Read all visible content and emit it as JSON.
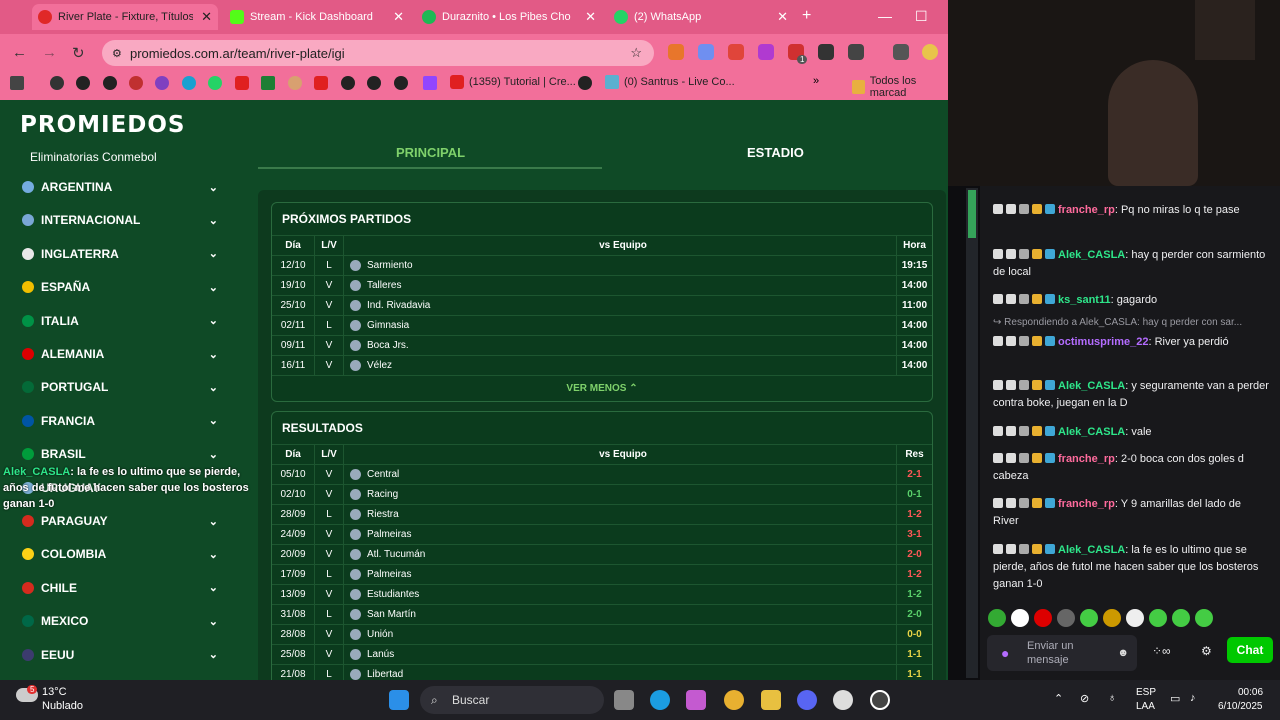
{
  "browser": {
    "tabs": [
      {
        "title": "River Plate - Fixture, Títulos y",
        "active": true
      },
      {
        "title": "Stream - Kick Dashboard"
      },
      {
        "title": "Duraznito • Los Pibes Cho"
      },
      {
        "title": "(2) WhatsApp"
      }
    ],
    "url": "promiedos.com.ar/team/river-plate/igi",
    "bookmarks": [
      "(1359) Tutorial | Cre...",
      "(0) Santrus - Live Co...",
      "Todos los marcad"
    ],
    "ext_badge": "1"
  },
  "site": {
    "logo": "PROMIEDOS",
    "subtitle": "Eliminatorias Conmebol",
    "countries": [
      {
        "name": "ARGENTINA",
        "color": "#74acdf"
      },
      {
        "name": "INTERNACIONAL",
        "color": "#7aa7d6"
      },
      {
        "name": "INGLATERRA",
        "color": "#e8e8e8"
      },
      {
        "name": "ESPAÑA",
        "color": "#f1bf00"
      },
      {
        "name": "ITALIA",
        "color": "#009246"
      },
      {
        "name": "ALEMANIA",
        "color": "#dd0000"
      },
      {
        "name": "PORTUGAL",
        "color": "#046a38"
      },
      {
        "name": "FRANCIA",
        "color": "#0055a4"
      },
      {
        "name": "BRASIL",
        "color": "#009c3b"
      },
      {
        "name": "URUGUAY",
        "color": "#7bafd4"
      },
      {
        "name": "PARAGUAY",
        "color": "#d52b1e"
      },
      {
        "name": "COLOMBIA",
        "color": "#fcd116"
      },
      {
        "name": "CHILE",
        "color": "#d52b1e"
      },
      {
        "name": "MEXICO",
        "color": "#006847"
      },
      {
        "name": "EEUU",
        "color": "#3c3b6e"
      }
    ],
    "tabs": {
      "principal": "PRINCIPAL",
      "estadio": "ESTADIO"
    },
    "proximos": {
      "title": "PRÓXIMOS PARTIDOS",
      "headers": [
        "Día",
        "L/V",
        "vs Equipo",
        "Hora"
      ],
      "rows": [
        {
          "dia": "12/10",
          "lv": "L",
          "equipo": "Sarmiento",
          "hora": "19:15"
        },
        {
          "dia": "19/10",
          "lv": "V",
          "equipo": "Talleres",
          "hora": "14:00"
        },
        {
          "dia": "25/10",
          "lv": "V",
          "equipo": "Ind. Rivadavia",
          "hora": "11:00"
        },
        {
          "dia": "02/11",
          "lv": "L",
          "equipo": "Gimnasia",
          "hora": "14:00"
        },
        {
          "dia": "09/11",
          "lv": "V",
          "equipo": "Boca Jrs.",
          "hora": "14:00"
        },
        {
          "dia": "16/11",
          "lv": "V",
          "equipo": "Vélez",
          "hora": "14:00"
        }
      ],
      "ver_menos": "VER MENOS ⌃"
    },
    "resultados": {
      "title": "RESULTADOS",
      "headers": [
        "Día",
        "L/V",
        "vs Equipo",
        "Res"
      ],
      "rows": [
        {
          "dia": "05/10",
          "lv": "V",
          "equipo": "Central",
          "res": "2-1",
          "color": "#ff5757"
        },
        {
          "dia": "02/10",
          "lv": "V",
          "equipo": "Racing",
          "res": "0-1",
          "color": "#5ad16b"
        },
        {
          "dia": "28/09",
          "lv": "L",
          "equipo": "Riestra",
          "res": "1-2",
          "color": "#ff5757"
        },
        {
          "dia": "24/09",
          "lv": "V",
          "equipo": "Palmeiras",
          "res": "3-1",
          "color": "#ff5757"
        },
        {
          "dia": "20/09",
          "lv": "V",
          "equipo": "Atl. Tucumán",
          "res": "2-0",
          "color": "#ff5757"
        },
        {
          "dia": "17/09",
          "lv": "L",
          "equipo": "Palmeiras",
          "res": "1-2",
          "color": "#ff5757"
        },
        {
          "dia": "13/09",
          "lv": "V",
          "equipo": "Estudiantes",
          "res": "1-2",
          "color": "#5ad16b"
        },
        {
          "dia": "31/08",
          "lv": "L",
          "equipo": "San Martín",
          "res": "2-0",
          "color": "#5ad16b"
        },
        {
          "dia": "28/08",
          "lv": "V",
          "equipo": "Unión",
          "res": "0-0",
          "color": "#e8d447"
        },
        {
          "dia": "25/08",
          "lv": "V",
          "equipo": "Lanús",
          "res": "1-1",
          "color": "#e8d447"
        },
        {
          "dia": "21/08",
          "lv": "L",
          "equipo": "Libertad",
          "res": "1-1",
          "color": "#e8d447"
        }
      ]
    }
  },
  "overlay_msg": {
    "user": "Alek_CASLA",
    "text": ": la fe es lo ultimo que se pierde, años de futol me hacen saber que los bosteros ganan 1-0"
  },
  "chat": {
    "messages": [
      {
        "user": "franche_rp",
        "color": "#ff6b9d",
        "text": ": Pq no miras lo q te pase"
      },
      {
        "user": "Alek_CASLA",
        "color": "#2ee68a",
        "text": ": hay q perder con sarmiento de local"
      },
      {
        "user": "ks_sant11",
        "color": "#2ee68a",
        "text": ": gagardo"
      },
      {
        "user": "octimusprime_22",
        "color": "#b46cff",
        "text": ": River ya perdió"
      },
      {
        "user": "Alek_CASLA",
        "color": "#2ee68a",
        "text": ": y seguramente van a perder contra boke, juegan en la D"
      },
      {
        "user": "Alek_CASLA",
        "color": "#2ee68a",
        "text": ": vale"
      },
      {
        "user": "franche_rp",
        "color": "#ff6b9d",
        "text": ": 2-0 boca con dos goles d cabeza"
      },
      {
        "user": "franche_rp",
        "color": "#ff6b9d",
        "text": ": Y 9 amarillas del lado de River"
      },
      {
        "user": "Alek_CASLA",
        "color": "#2ee68a",
        "text": ": la fe es lo ultimo que se pierde, años de futol me hacen saber que los bosteros ganan 1-0"
      }
    ],
    "reply_label": "Respondiendo a Alek_CASLA: hay q perder con sar...",
    "input_placeholder": "Enviar un mensaje",
    "chat_button": "Chat"
  },
  "taskbar": {
    "weather_temp": "13°C",
    "weather_desc": "Nublado",
    "weather_badge": "5",
    "search": "Buscar",
    "lang": "ESP",
    "lang2": "LAA",
    "time": "00:06",
    "date": "6/10/2025"
  }
}
